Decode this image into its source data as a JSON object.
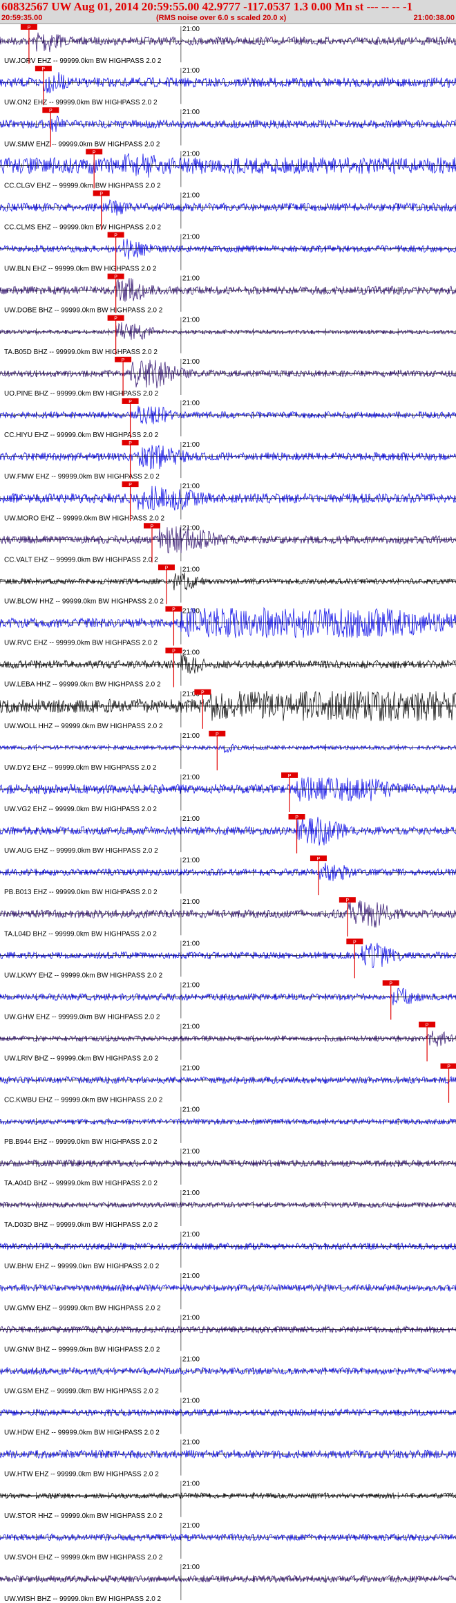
{
  "header": {
    "title": "60832567 UW Aug 01, 2014 20:59:55.00   42.9777 -117.0537  1.3 0.00 Mn st --- -- --  -1",
    "start_time": "20:59:35.00",
    "note": "(RMS noise over 6.0 s scaled 20.0 x)",
    "end_time": "21:00:38.00"
  },
  "chart_data": {
    "type": "line",
    "x_start": "20:59:35.00",
    "x_end": "21:00:38.00",
    "minute_label": "21:00",
    "minute_time": "21:00:00",
    "grid": true,
    "pick_label": "P",
    "colors": {
      "blue": "#0000e6",
      "purple": "#2a0a6a",
      "black": "#000000",
      "red": "#e00000",
      "grid": "#000000"
    },
    "traces": [
      {
        "label": "UW.JORV EHZ -- 99999.0km BW  HIGHPASS  2.0  2",
        "color": "purple",
        "amp": 6,
        "pick": "20:59:39.00",
        "burst": {
          "t": "20:59:40.00",
          "dur": 2,
          "amp": 18
        }
      },
      {
        "label": "UW.ON2 EHZ -- 99999.0km BW  HIGHPASS  2.0  2",
        "color": "blue",
        "amp": 7,
        "pick": "20:59:41.00",
        "burst": {
          "t": "20:59:41.00",
          "dur": 2,
          "amp": 16
        }
      },
      {
        "label": "UW.SMW EHZ -- 99999.0km BW  HIGHPASS  2.0  2",
        "color": "blue",
        "amp": 6,
        "pick": "20:59:42.00",
        "burst": {
          "t": "20:59:42.00",
          "dur": 1,
          "amp": 12
        }
      },
      {
        "label": "CC.CLGV EHZ -- 99999.0km BW  HIGHPASS  2.0  2",
        "color": "blue",
        "amp": 12,
        "pick": "20:59:48.00",
        "burst": {
          "t": "20:59:52.00",
          "dur": 4,
          "amp": 18
        }
      },
      {
        "label": "CC.CLMS EHZ -- 99999.0km BW  HIGHPASS  2.0  2",
        "color": "blue",
        "amp": 6,
        "pick": "20:59:49.00",
        "burst": {
          "t": "20:59:50.00",
          "dur": 2,
          "amp": 12
        }
      },
      {
        "label": "UW.BLN EHZ -- 99999.0km BW  HIGHPASS  2.0  2",
        "color": "blue",
        "amp": 5,
        "pick": "20:59:51.00",
        "burst": {
          "t": "20:59:52.00",
          "dur": 2,
          "amp": 16
        }
      },
      {
        "label": "UW.DOBE BHZ -- 99999.0km BW  HIGHPASS  2.0  2",
        "color": "purple",
        "amp": 6,
        "pick": "20:59:51.00",
        "burst": {
          "t": "20:59:51.00",
          "dur": 3,
          "amp": 18
        }
      },
      {
        "label": "TA.B05D BHZ -- 99999.0km BW  HIGHPASS  2.0  2",
        "color": "purple",
        "amp": 3,
        "pick": "20:59:51.00",
        "burst": {
          "t": "20:59:51.00",
          "dur": 3,
          "amp": 14
        }
      },
      {
        "label": "UO.PINE BHZ -- 99999.0km BW  HIGHPASS  2.0  2",
        "color": "purple",
        "amp": 5,
        "pick": "20:59:52.00",
        "burst": {
          "t": "20:59:53.00",
          "dur": 4,
          "amp": 22
        }
      },
      {
        "label": "CC.HIYU EHZ -- 99999.0km BW  HIGHPASS  2.0  2",
        "color": "blue",
        "amp": 5,
        "pick": "20:59:53.00",
        "burst": {
          "t": "20:59:54.00",
          "dur": 3,
          "amp": 14
        }
      },
      {
        "label": "UW.FMW EHZ -- 99999.0km BW  HIGHPASS  2.0  2",
        "color": "blue",
        "amp": 6,
        "pick": "20:59:53.00",
        "burst": {
          "t": "20:59:54.00",
          "dur": 4,
          "amp": 18
        }
      },
      {
        "label": "UW.MORO EHZ -- 99999.0km BW  HIGHPASS  2.0  2",
        "color": "blue",
        "amp": 7,
        "pick": "20:59:53.00",
        "burst": {
          "t": "20:59:54.00",
          "dur": 6,
          "amp": 18
        }
      },
      {
        "label": "CC.VALT EHZ -- 99999.0km BW  HIGHPASS  2.0  2",
        "color": "purple",
        "amp": 6,
        "pick": "20:59:56.00",
        "burst": {
          "t": "20:59:57.00",
          "dur": 5,
          "amp": 20
        }
      },
      {
        "label": "UW.BLOW HHZ -- 99999.0km BW  HIGHPASS  2.0  2",
        "color": "black",
        "amp": 4,
        "pick": "20:59:58.00",
        "burst": {
          "t": "20:59:59.00",
          "dur": 2,
          "amp": 14
        }
      },
      {
        "label": "UW.RVC EHZ -- 99999.0km BW  HIGHPASS  2.0  2",
        "color": "blue",
        "amp": 7,
        "pick": "20:59:59.00",
        "burst": {
          "t": "21:00:00.00",
          "dur": 28,
          "amp": 22
        }
      },
      {
        "label": "UW.LEBA HHZ -- 99999.0km BW  HIGHPASS  2.0  2",
        "color": "black",
        "amp": 6,
        "pick": "20:59:59.00",
        "burst": {
          "t": "21:00:00.00",
          "dur": 2,
          "amp": 14
        }
      },
      {
        "label": "UW.WOLL HHZ -- 99999.0km BW  HIGHPASS  2.0  2",
        "color": "black",
        "amp": 10,
        "pick": "21:00:03.00",
        "burst": {
          "t": "21:00:04.00",
          "dur": 34,
          "amp": 22
        }
      },
      {
        "label": "UW.DY2 EHZ -- 99999.0km BW  HIGHPASS  2.0  2",
        "color": "blue",
        "amp": 3,
        "pick": "21:00:05.00",
        "burst": {
          "t": "21:00:06.00",
          "dur": 1,
          "amp": 8
        }
      },
      {
        "label": "UW.VG2 EHZ -- 99999.0km BW  HIGHPASS  2.0  2",
        "color": "blue",
        "amp": 7,
        "pick": "21:00:15.00",
        "burst": {
          "t": "21:00:16.00",
          "dur": 10,
          "amp": 18
        }
      },
      {
        "label": "UW.AUG EHZ -- 99999.0km BW  HIGHPASS  2.0  2",
        "color": "blue",
        "amp": 6,
        "pick": "21:00:16.00",
        "burst": {
          "t": "21:00:16.00",
          "dur": 4,
          "amp": 22
        }
      },
      {
        "label": "PB.B013 EHZ -- 99999.0km BW  HIGHPASS  2.0  2",
        "color": "blue",
        "amp": 5,
        "pick": "21:00:19.00",
        "burst": {
          "t": "21:00:19.00",
          "dur": 3,
          "amp": 14
        }
      },
      {
        "label": "TA.L04D BHZ -- 99999.0km BW  HIGHPASS  2.0  2",
        "color": "purple",
        "amp": 6,
        "pick": "21:00:23.00",
        "burst": {
          "t": "21:00:23.00",
          "dur": 4,
          "amp": 20
        }
      },
      {
        "label": "UW.LKWY EHZ -- 99999.0km BW  HIGHPASS  2.0  2",
        "color": "blue",
        "amp": 5,
        "pick": "21:00:24.00",
        "burst": {
          "t": "21:00:25.00",
          "dur": 3,
          "amp": 18
        }
      },
      {
        "label": "UW.GHW EHZ -- 99999.0km BW  HIGHPASS  2.0  2",
        "color": "blue",
        "amp": 5,
        "pick": "21:00:29.00",
        "burst": {
          "t": "21:00:29.00",
          "dur": 2,
          "amp": 14
        }
      },
      {
        "label": "UW.LRIV BHZ -- 99999.0km BW  HIGHPASS  2.0  2",
        "color": "purple",
        "amp": 4,
        "pick": "21:00:34.00",
        "burst": {
          "t": "21:00:34.00",
          "dur": 2,
          "amp": 12
        }
      },
      {
        "label": "CC.KWBU EHZ -- 99999.0km BW  HIGHPASS  2.0  2",
        "color": "blue",
        "amp": 5,
        "pick": "21:00:37.00"
      },
      {
        "label": "PB.B944 EHZ -- 99999.0km BW  HIGHPASS  2.0  2",
        "color": "blue",
        "amp": 4
      },
      {
        "label": "TA.A04D BHZ -- 99999.0km BW  HIGHPASS  2.0  2",
        "color": "purple",
        "amp": 5
      },
      {
        "label": "TA.D03D BHZ -- 99999.0km BW  HIGHPASS  2.0  2",
        "color": "purple",
        "amp": 4
      },
      {
        "label": "UW.BHW EHZ -- 99999.0km BW  HIGHPASS  2.0  2",
        "color": "blue",
        "amp": 5
      },
      {
        "label": "UW.GMW EHZ -- 99999.0km BW  HIGHPASS  2.0  2",
        "color": "blue",
        "amp": 5
      },
      {
        "label": "UW.GNW BHZ -- 99999.0km BW  HIGHPASS  2.0  2",
        "color": "purple",
        "amp": 5
      },
      {
        "label": "UW.GSM EHZ -- 99999.0km BW  HIGHPASS  2.0  2",
        "color": "blue",
        "amp": 5
      },
      {
        "label": "UW.HDW EHZ -- 99999.0km BW  HIGHPASS  2.0  2",
        "color": "blue",
        "amp": 5
      },
      {
        "label": "UW.HTW EHZ -- 99999.0km BW  HIGHPASS  2.0  2",
        "color": "blue",
        "amp": 6
      },
      {
        "label": "UW.STOR HHZ -- 99999.0km BW  HIGHPASS  2.0  2",
        "color": "black",
        "amp": 4
      },
      {
        "label": "UW.SVOH EHZ -- 99999.0km BW  HIGHPASS  2.0  2",
        "color": "blue",
        "amp": 5
      },
      {
        "label": "UW.WISH BHZ -- 99999.0km BW  HIGHPASS  2.0  2",
        "color": "purple",
        "amp": 5
      }
    ]
  }
}
